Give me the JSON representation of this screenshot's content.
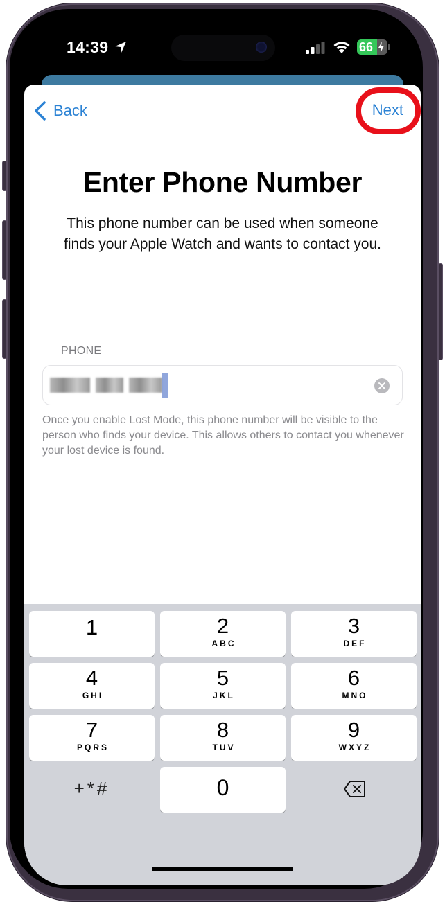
{
  "status_bar": {
    "time": "14:39",
    "battery_percent": "66",
    "battery_level": 0.66,
    "charging": true,
    "signal_bars_active": 2,
    "signal_bars_total": 4
  },
  "nav": {
    "back_label": "Back",
    "next_label": "Next"
  },
  "header": {
    "title": "Enter Phone Number",
    "subtitle": "This phone number can be used when someone finds your Apple Watch and wants to contact you."
  },
  "phone_field": {
    "label": "PHONE",
    "value_redacted": true
  },
  "footnote": "Once you enable Lost Mode, this phone number will be visible to the person who finds your device. This allows others to contact you whenever your lost device is found.",
  "keypad": {
    "keys": [
      {
        "num": "1",
        "letters": ""
      },
      {
        "num": "2",
        "letters": "ABC"
      },
      {
        "num": "3",
        "letters": "DEF"
      },
      {
        "num": "4",
        "letters": "GHI"
      },
      {
        "num": "5",
        "letters": "JKL"
      },
      {
        "num": "6",
        "letters": "MNO"
      },
      {
        "num": "7",
        "letters": "PQRS"
      },
      {
        "num": "8",
        "letters": "TUV"
      },
      {
        "num": "9",
        "letters": "WXYZ"
      }
    ],
    "symbols_label": "+*#",
    "zero": "0"
  },
  "colors": {
    "accent": "#2b82d4",
    "highlight": "#e8101a",
    "battery": "#34c759",
    "keypad_bg": "#d1d3d9"
  }
}
